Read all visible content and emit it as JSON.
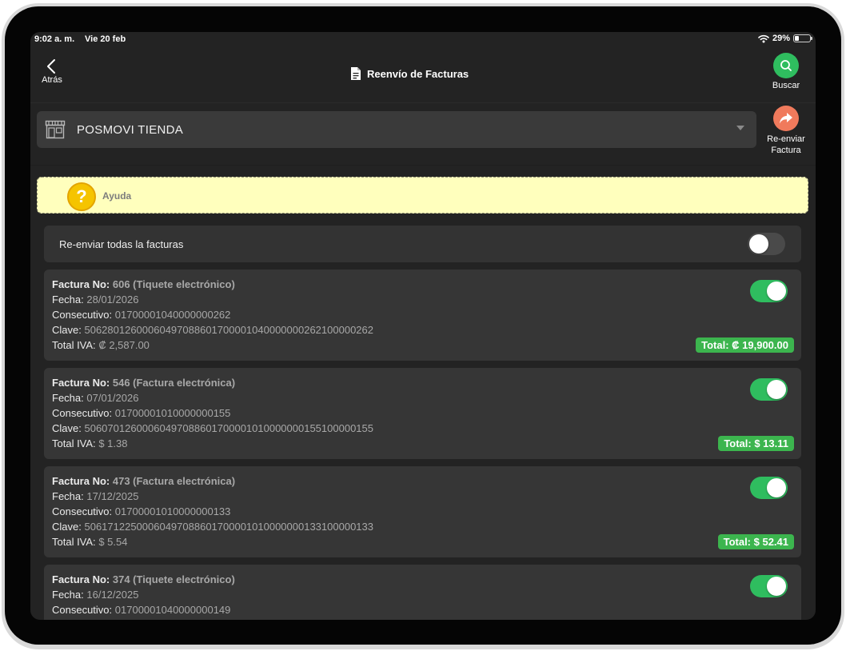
{
  "status_bar": {
    "time": "9:02 a. m.",
    "date": "Vie 20 feb",
    "battery": "29%",
    "battery_level": 0.29
  },
  "nav": {
    "back_label": "Atrás",
    "title": "Reenvío de Facturas",
    "search_label": "Buscar"
  },
  "store": {
    "name": "POSMOVI TIENDA"
  },
  "resend_button": {
    "line1": "Re-enviar",
    "line2": "Factura"
  },
  "help": {
    "label": "Ayuda",
    "icon_glyph": "?"
  },
  "resend_all": {
    "label": "Re-enviar todas la facturas",
    "enabled": false
  },
  "labels": {
    "invoice_no": "Factura No:",
    "date": "Fecha:",
    "consecutive": "Consecutivo:",
    "key": "Clave:",
    "total_iva": "Total IVA:"
  },
  "invoices": [
    {
      "number_type": "606 (Tiquete electrónico)",
      "date": "28/01/2026",
      "consecutive": "01700001040000000262",
      "key": "50628012600060497088601700001040000000262100000262",
      "total_iva": "₡ 2,587.00",
      "total": "Total: ₡ 19,900.00",
      "selected": true
    },
    {
      "number_type": "546 (Factura electrónica)",
      "date": "07/01/2026",
      "consecutive": "01700001010000000155",
      "key": "50607012600060497088601700001010000000155100000155",
      "total_iva": "$ 1.38",
      "total": "Total: $ 13.11",
      "selected": true
    },
    {
      "number_type": "473 (Factura electrónica)",
      "date": "17/12/2025",
      "consecutive": "01700001010000000133",
      "key": "50617122500060497088601700001010000000133100000133",
      "total_iva": "$ 5.54",
      "total": "Total: $ 52.41",
      "selected": true
    },
    {
      "number_type": "374 (Tiquete electrónico)",
      "date": "16/12/2025",
      "consecutive": "01700001040000000149",
      "selected": true
    }
  ],
  "colors": {
    "accent_green": "#2fbd5f",
    "total_badge": "#3cb54e",
    "resend_orange": "#f07a5c",
    "help_bg": "#ffffbd",
    "help_icon": "#f5c400"
  }
}
